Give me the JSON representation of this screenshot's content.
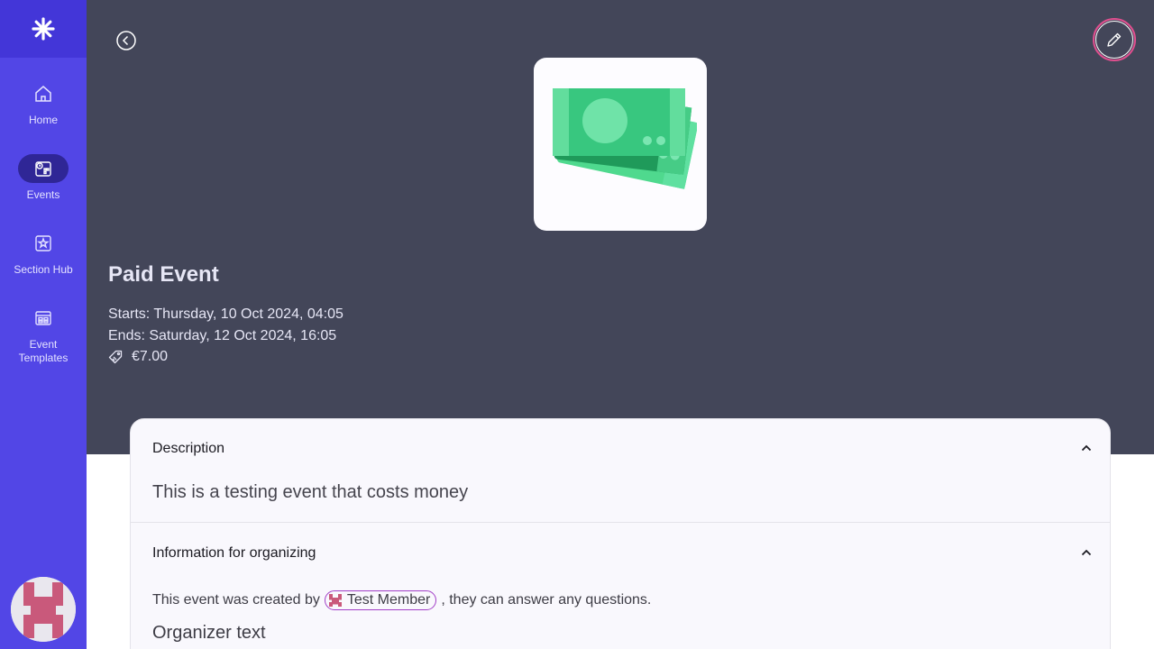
{
  "sidebar": {
    "logo_icon": "asterisk-icon",
    "items": [
      {
        "label": "Home",
        "icon": "home-icon"
      },
      {
        "label": "Events",
        "icon": "events-icon",
        "active": true
      },
      {
        "label": "Section Hub",
        "icon": "section-hub-icon"
      },
      {
        "label": "Event Templates",
        "icon": "template-icon"
      }
    ]
  },
  "event": {
    "title": "Paid Event",
    "starts": "Starts: Thursday, 10 Oct 2024, 04:05",
    "ends": "Ends: Saturday, 12 Oct 2024, 16:05",
    "price": "€7.00"
  },
  "card": {
    "description_header": "Description",
    "description_text": "This is a testing event that costs money",
    "organizing_header": "Information for organizing",
    "created_prefix": "This event was created by",
    "member_name": "Test Member",
    "created_suffix": ", they can answer any questions.",
    "organizer_text": "Organizer text"
  },
  "colors": {
    "sidebar": "#5246e6",
    "header": "#434659",
    "accent": "#e04f8f"
  }
}
